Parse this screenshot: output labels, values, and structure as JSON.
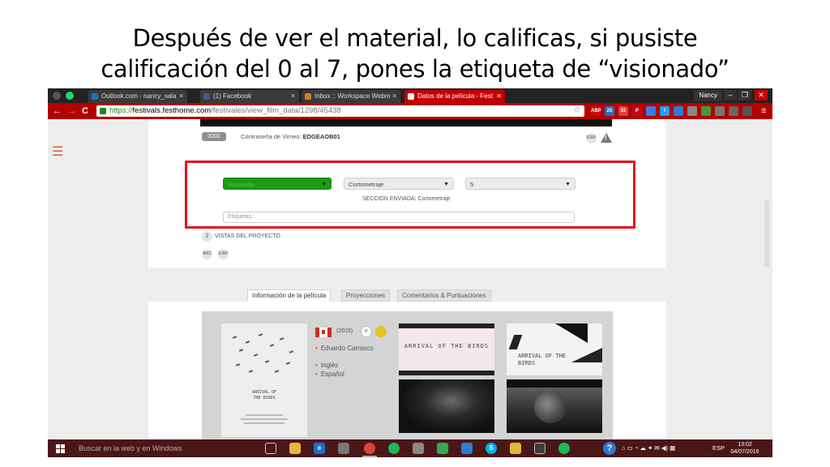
{
  "slide": {
    "title_line1": "Después de ver el material, lo calificas, si pusiste",
    "title_line2": "calificación del 0 al 7, pones la etiqueta de “visionado”"
  },
  "browser": {
    "tabs": [
      {
        "label": "Outlook.com - nancy_sala",
        "color": "#1a73c7"
      },
      {
        "label": "(1) Facebook",
        "color": "#3b5998"
      },
      {
        "label": "Inbox :: Workspace Webm",
        "color": "#d97b22"
      },
      {
        "label": "Datos de la película - Fest",
        "color": "#c40000",
        "active": true
      }
    ],
    "user": "Nancy",
    "url_scheme": "https://",
    "url_host": "festivals.festhome.com",
    "url_path": "/festivales/view_film_data/1298/45438",
    "extensions": [
      {
        "name": "adblock-plus-icon",
        "label": "ABP",
        "color": "#c70d0d"
      },
      {
        "name": "extension-icon",
        "label": "25",
        "color": "#2d6cc0"
      },
      {
        "name": "gmail-icon",
        "label": "31",
        "color": "#d4463a"
      },
      {
        "name": "pinterest-icon",
        "label": "P",
        "color": "#bd081c"
      },
      {
        "name": "extension-blue-icon",
        "label": "",
        "color": "#3b7de0"
      },
      {
        "name": "twitter-icon",
        "label": "t",
        "color": "#1da1f2"
      },
      {
        "name": "dropbox-icon",
        "label": "",
        "color": "#2a7ed6"
      },
      {
        "name": "pocket-icon",
        "label": "",
        "color": "#888"
      },
      {
        "name": "extension-green-icon",
        "label": "",
        "color": "#3c9a3c"
      },
      {
        "name": "extension-gray-icon",
        "label": "",
        "color": "#777"
      },
      {
        "name": "puzzle-icon",
        "label": "",
        "color": "#666"
      },
      {
        "name": "extension-dark-icon",
        "label": "",
        "color": "#555"
      }
    ]
  },
  "film": {
    "code": "0002",
    "vimeo_label": "Contraseña de Vimeo:",
    "vimeo_password": "EDGEAOB01",
    "lang_badge": "ESP",
    "status_select": "Visionado",
    "section_select": "Cortometraje",
    "rating_select": "5",
    "section_sent": "SECCIÓN ENVIADA: Cortometraje",
    "tags_placeholder": "Etiquetas...",
    "views_count": "2",
    "views_label": "VISTAS DEL PROYECTO",
    "bio_label": "BIO",
    "bio_lang": "ESP"
  },
  "tabs": [
    {
      "label": "Información de la película",
      "active": true
    },
    {
      "label": "Proyecciones"
    },
    {
      "label": "Comentarios & Puntuaciones"
    }
  ],
  "info": {
    "year": "(2015)",
    "duration": "6'",
    "director": "Eduardo Carrasco",
    "languages": [
      "Inglés",
      "Español"
    ],
    "poster_title": "ARRIVAL OF\nTHE BIRDS",
    "thumb1_title": "ARRIVAL OF\nTHE BIRDS",
    "thumb2_title": "ARRIVAL OF\nTHE BIRDS"
  },
  "taskbar": {
    "search_placeholder": "Buscar en la web y en Windows",
    "lang": "ESP",
    "time": "13:02",
    "date": "04/07/2016"
  }
}
